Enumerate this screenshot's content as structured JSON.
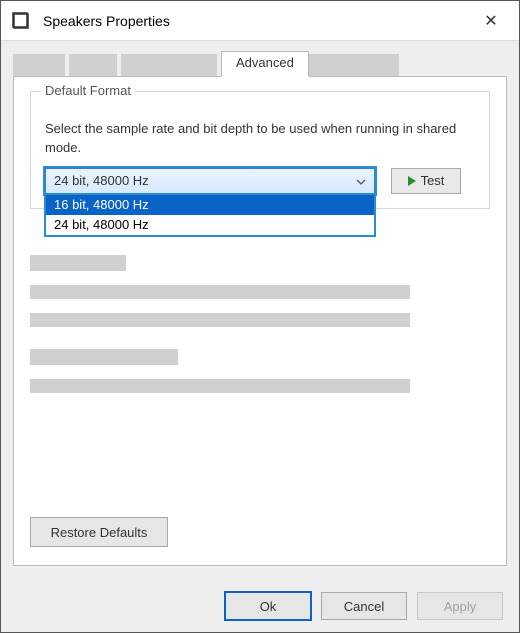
{
  "window": {
    "title": "Speakers Properties",
    "close_glyph": "✕"
  },
  "tabs": {
    "active_label": "Advanced"
  },
  "default_format": {
    "legend": "Default Format",
    "description": "Select the sample rate and bit depth to be used when running in shared mode.",
    "selected": "24 bit, 48000 Hz",
    "options": {
      "opt0": "16 bit, 48000 Hz",
      "opt1": "24 bit, 48000 Hz"
    },
    "test_label": "Test"
  },
  "buttons": {
    "restore": "Restore Defaults",
    "ok": "Ok",
    "cancel": "Cancel",
    "apply": "Apply"
  }
}
